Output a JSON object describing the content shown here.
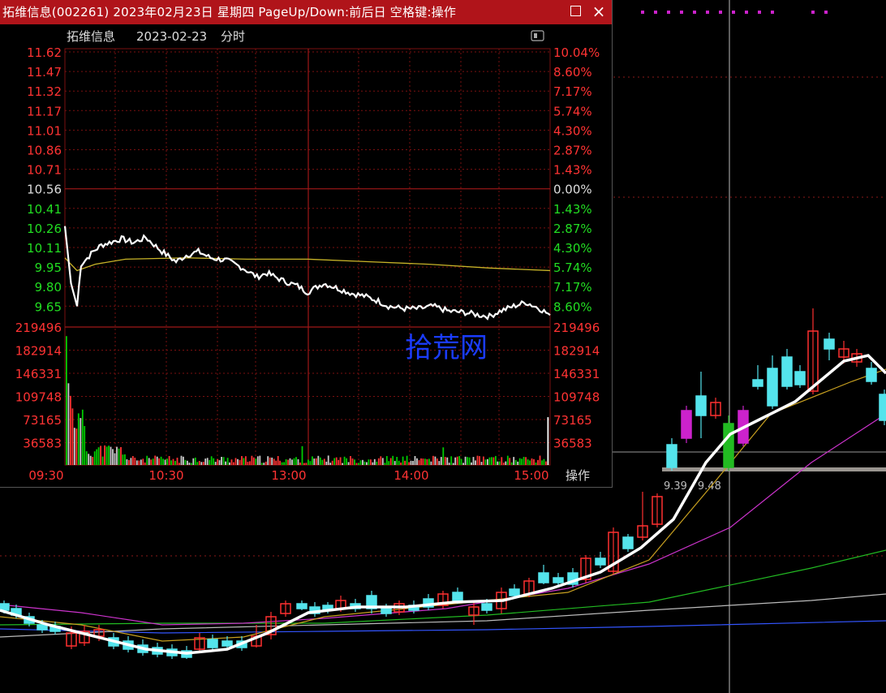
{
  "window": {
    "title": "拓维信息(002261) 2023年02月23日 星期四 PageUp/Down:前后日 空格键:操作",
    "restore_label": "□",
    "close_label": "×"
  },
  "chart_header": {
    "stock_name": "拓维信息",
    "date": "2023-02-23",
    "mode": "分时"
  },
  "price_axis": {
    "prices": [
      "11.62",
      "11.47",
      "11.32",
      "11.17",
      "11.01",
      "10.86",
      "10.71",
      "10.56",
      "10.41",
      "10.26",
      "10.11",
      "9.95",
      "9.80",
      "9.65"
    ],
    "percents": [
      "10.04%",
      "8.60%",
      "7.17%",
      "5.74%",
      "4.30%",
      "2.87%",
      "1.43%",
      "0.00%",
      "1.43%",
      "2.87%",
      "4.30%",
      "5.74%",
      "7.17%",
      "8.60%"
    ],
    "prev_close": "10.56"
  },
  "volume_axis": {
    "labels": [
      "219496",
      "182914",
      "146331",
      "109748",
      "73165",
      "36583"
    ]
  },
  "time_axis": {
    "labels": [
      "09:30",
      "10:30",
      "13:00",
      "14:00",
      "15:00"
    ]
  },
  "operate_label": "操作",
  "watermark": "拾荒网",
  "range_label": "9.39  -  9.48",
  "colors": {
    "up": "#ff3333",
    "down": "#00cc00",
    "flat": "#cccccc",
    "price_line": "#ffffff",
    "avg_line": "#c8b428",
    "grid": "#7a1010",
    "title_bar": "#b0141a",
    "bg_candle_down": "#54e4ec",
    "bg_candle_up": "#ff3030",
    "bg_limit_up": "#cc22cc",
    "watermark": "#1a3cff"
  },
  "chart_data": {
    "type": "line",
    "title": "拓维信息 2023-02-23 分时",
    "x_ticks": [
      "09:30",
      "10:30",
      "13:00",
      "14:00",
      "15:00"
    ],
    "ylim": [
      9.5,
      11.62
    ],
    "prev_close": 10.56,
    "series": [
      {
        "name": "price",
        "x_minutes": [
          0,
          3,
          6,
          8,
          10,
          14,
          18,
          22,
          28,
          34,
          40,
          48,
          55,
          60,
          66,
          72,
          80,
          88,
          95,
          100,
          108,
          115,
          120,
          128,
          135,
          142,
          148,
          155,
          160,
          168,
          175,
          182,
          190,
          198,
          205,
          210,
          215,
          222,
          228,
          235,
          240
        ],
        "values": [
          10.25,
          9.8,
          9.62,
          9.95,
          9.98,
          10.05,
          10.1,
          10.12,
          10.15,
          10.12,
          10.16,
          10.05,
          9.97,
          10.02,
          10.05,
          10.0,
          9.98,
          9.92,
          9.85,
          9.88,
          9.82,
          9.78,
          9.73,
          9.8,
          9.76,
          9.72,
          9.7,
          9.66,
          9.62,
          9.6,
          9.6,
          9.62,
          9.58,
          9.57,
          9.55,
          9.54,
          9.58,
          9.62,
          9.65,
          9.6,
          9.55
        ]
      },
      {
        "name": "avg",
        "x_minutes": [
          0,
          6,
          15,
          30,
          60,
          90,
          120,
          150,
          180,
          210,
          240
        ],
        "values": [
          10.0,
          9.9,
          9.95,
          9.99,
          10.0,
          9.99,
          9.99,
          9.97,
          9.95,
          9.92,
          9.9
        ]
      }
    ],
    "volume_ylim": [
      0,
      219496
    ],
    "volume_bars_count": 240
  }
}
